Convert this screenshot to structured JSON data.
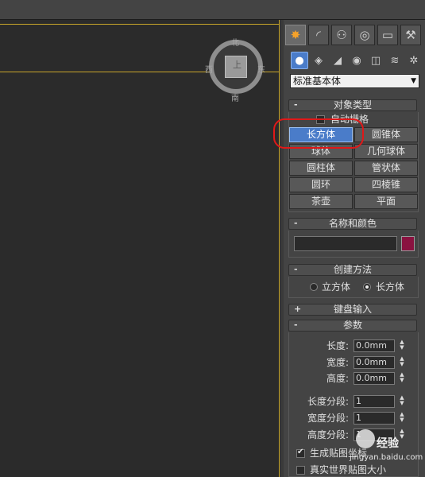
{
  "viewport": {
    "viewcube": {
      "north": "北",
      "south": "南",
      "west": "西",
      "east": "东",
      "face": "上"
    }
  },
  "command_panel": {
    "tabs": [
      {
        "icon": "create-icon",
        "glyph": "✸",
        "active": true
      },
      {
        "icon": "modify-icon",
        "glyph": "◜",
        "active": false
      },
      {
        "icon": "hierarchy-icon",
        "glyph": "⚇",
        "active": false
      },
      {
        "icon": "motion-icon",
        "glyph": "◎",
        "active": false
      },
      {
        "icon": "display-icon",
        "glyph": "▭",
        "active": false
      },
      {
        "icon": "utilities-icon",
        "glyph": "⚒",
        "active": false
      }
    ],
    "subcategories": [
      {
        "icon": "geometry-icon",
        "glyph": "●",
        "active": true
      },
      {
        "icon": "shapes-icon",
        "glyph": "◈",
        "active": false
      },
      {
        "icon": "lights-icon",
        "glyph": "◢",
        "active": false
      },
      {
        "icon": "cameras-icon",
        "glyph": "◉",
        "active": false
      },
      {
        "icon": "helpers-icon",
        "glyph": "◫",
        "active": false
      },
      {
        "icon": "space-warps-icon",
        "glyph": "≋",
        "active": false
      },
      {
        "icon": "systems-icon",
        "glyph": "✲",
        "active": false
      }
    ],
    "category_dropdown": "标准基本体"
  },
  "object_type": {
    "header": "对象类型",
    "sign": "-",
    "autogrid_label": "自动栅格",
    "buttons": [
      "长方体",
      "圆锥体",
      "球体",
      "几何球体",
      "圆柱体",
      "管状体",
      "圆环",
      "四棱锥",
      "茶壶",
      "平面"
    ]
  },
  "name_color": {
    "header": "名称和颜色",
    "sign": "-",
    "swatch_color": "#8a1240"
  },
  "creation_method": {
    "header": "创建方法",
    "sign": "-",
    "options": [
      "立方体",
      "长方体"
    ],
    "selected": 1
  },
  "keyboard_entry": {
    "header": "键盘输入",
    "sign": "+"
  },
  "parameters": {
    "header": "参数",
    "sign": "-",
    "length_label": "长度:",
    "length_value": "0.0mm",
    "width_label": "宽度:",
    "width_value": "0.0mm",
    "height_label": "高度:",
    "height_value": "0.0mm",
    "length_segs_label": "长度分段:",
    "length_segs_value": "1",
    "width_segs_label": "宽度分段:",
    "width_segs_value": "1",
    "height_segs_label": "高度分段:",
    "height_segs_value": "1",
    "gen_mapping_label": "生成贴图坐标",
    "real_world_label": "真实世界贴图大小"
  },
  "watermark": {
    "text": "经验",
    "url": "jingyan.baidu.com"
  }
}
